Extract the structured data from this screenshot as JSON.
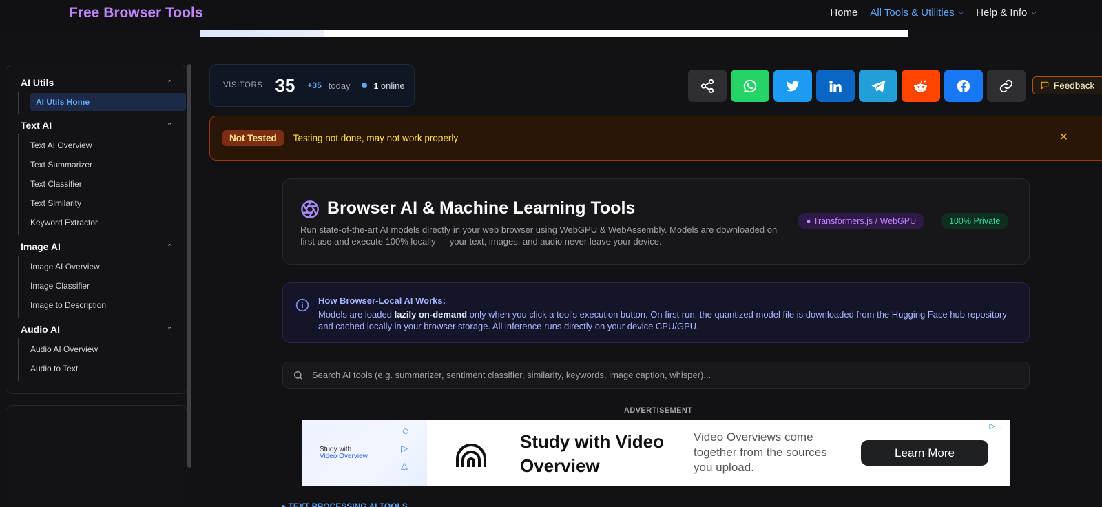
{
  "brand": "Free Browser Tools",
  "nav": {
    "home": "Home",
    "tools": "All Tools & Utilities",
    "help": "Help & Info"
  },
  "sidebar": {
    "groups": [
      {
        "title": "AI Utils",
        "items": [
          "AI Utils Home"
        ]
      },
      {
        "title": "Text AI",
        "items": [
          "Text AI Overview",
          "Text Summarizer",
          "Text Classifier",
          "Text Similarity",
          "Keyword Extractor"
        ]
      },
      {
        "title": "Image AI",
        "items": [
          "Image AI Overview",
          "Image Classifier",
          "Image to Description"
        ]
      },
      {
        "title": "Audio AI",
        "items": [
          "Audio AI Overview",
          "Audio to Text"
        ]
      }
    ]
  },
  "visitors": {
    "label": "VISITORS",
    "count": "35",
    "today_num": "+35",
    "today_label": "today",
    "online_num": "1",
    "online_label": "online"
  },
  "share": {
    "buttons": [
      {
        "name": "share",
        "color": "#2f2f33"
      },
      {
        "name": "whatsapp",
        "color": "#25d366"
      },
      {
        "name": "twitter",
        "color": "#1d9bf0"
      },
      {
        "name": "linkedin",
        "color": "#0a66c2"
      },
      {
        "name": "telegram",
        "color": "#229ed9"
      },
      {
        "name": "reddit",
        "color": "#ff4500"
      },
      {
        "name": "facebook",
        "color": "#1877f2"
      },
      {
        "name": "copy-link",
        "color": "#2f2f33"
      }
    ],
    "feedback": "Feedback"
  },
  "warning": {
    "badge": "Not Tested",
    "text": "Testing not done, may not work properly"
  },
  "hero": {
    "title": "Browser AI & Machine Learning Tools",
    "desc": "Run state-of-the-art AI models directly in your web browser using WebGPU & WebAssembly. Models are downloaded on first use and execute 100% locally — your text, images, and audio never leave your device.",
    "tag1": "● Transformers.js / WebGPU",
    "tag2": "100% Private"
  },
  "info": {
    "title": "How Browser-Local AI Works:",
    "body_pre": "Models are loaded ",
    "body_bold": "lazily on-demand",
    "body_post": " only when you click a tool's execution button. On first run, the quantized model file is downloaded from the Hugging Face hub repository and cached locally in your browser storage. All inference runs directly on your device CPU/GPU."
  },
  "search": {
    "placeholder": "Search AI tools (e.g. summarizer, sentiment classifier, similarity, keywords, image caption, whisper)..."
  },
  "ad": {
    "label": "ADVERTISEMENT",
    "thumb_line1": "Study with",
    "thumb_line2": "Video Overview",
    "headline": "Study with Video Overview",
    "sub": "Video Overviews come together from the sources you upload.",
    "cta": "Learn More"
  },
  "section_peek": "● TEXT PROCESSING AI TOOLS"
}
